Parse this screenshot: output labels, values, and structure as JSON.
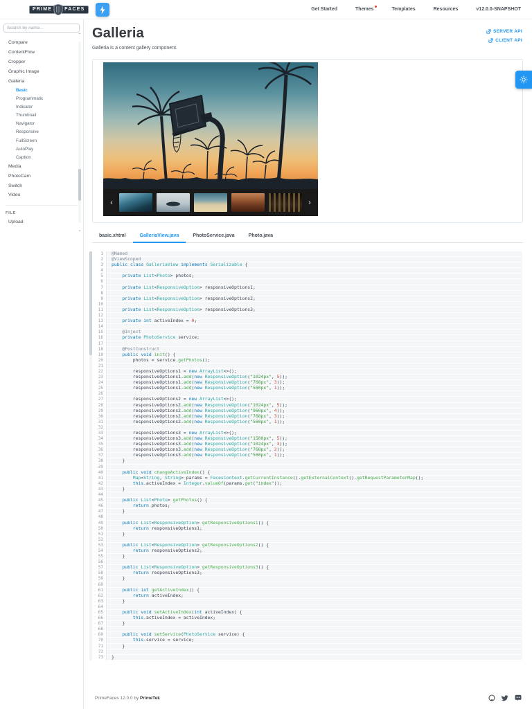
{
  "topbar": {
    "logo": {
      "left": "PRIME",
      "right": "FACES"
    },
    "nav_items": [
      {
        "label": "Get Started",
        "badge": false
      },
      {
        "label": "Themes",
        "badge": true
      },
      {
        "label": "Templates",
        "badge": false
      },
      {
        "label": "Resources",
        "badge": false
      },
      {
        "label": "v12.0.0-SNAPSHOT",
        "badge": false
      }
    ]
  },
  "sidebar": {
    "search_placeholder": "Search by name...",
    "items": [
      {
        "type": "item",
        "label": "Compare"
      },
      {
        "type": "item",
        "label": "ContentFlow"
      },
      {
        "type": "item",
        "label": "Cropper"
      },
      {
        "type": "item",
        "label": "Graphic Image"
      },
      {
        "type": "item",
        "label": "Galleria"
      },
      {
        "type": "sub",
        "label": "Basic",
        "active": true
      },
      {
        "type": "sub",
        "label": "Programmatic"
      },
      {
        "type": "sub",
        "label": "Indicator"
      },
      {
        "type": "sub",
        "label": "Thumbnail"
      },
      {
        "type": "sub",
        "label": "Navigator"
      },
      {
        "type": "sub",
        "label": "Responsive"
      },
      {
        "type": "sub",
        "label": "FullScreen"
      },
      {
        "type": "sub",
        "label": "AutoPlay"
      },
      {
        "type": "sub",
        "label": "Caption"
      },
      {
        "type": "item",
        "label": "Media"
      },
      {
        "type": "item",
        "label": "PhotoCam"
      },
      {
        "type": "item",
        "label": "Switch"
      },
      {
        "type": "item",
        "label": "Video"
      },
      {
        "type": "divider"
      },
      {
        "type": "section",
        "label": "FILE"
      },
      {
        "type": "item",
        "label": "Upload"
      }
    ]
  },
  "page": {
    "title": "Galleria",
    "subtitle": "Galleria is a content gallery component."
  },
  "api_links": [
    {
      "label": "SERVER API"
    },
    {
      "label": "CLIENT API"
    }
  ],
  "galleria": {
    "main_image": "basketball-hoop-palm-trees-sunset",
    "thumbnails": [
      {
        "name": "harbor-city"
      },
      {
        "name": "ship-at-sea"
      },
      {
        "name": "palm-sunset"
      },
      {
        "name": "red-mountains"
      },
      {
        "name": "dark-building"
      }
    ]
  },
  "icons": {
    "scroll_up": "⌃",
    "scroll_down": "⌄",
    "chevron_left": "‹",
    "chevron_right": "›"
  },
  "tabs": [
    {
      "label": "basic.xhtml",
      "active": false
    },
    {
      "label": "GalleriaView.java",
      "active": true
    },
    {
      "label": "PhotoService.java",
      "active": false
    },
    {
      "label": "Photo.java",
      "active": false
    }
  ],
  "code": {
    "language": "java",
    "lines": [
      "@Named",
      "@ViewScoped",
      "public class GalleriaView implements Serializable {",
      "",
      "    private List<Photo> photos;",
      "",
      "    private List<ResponsiveOption> responsiveOptions1;",
      "",
      "    private List<ResponsiveOption> responsiveOptions2;",
      "",
      "    private List<ResponsiveOption> responsiveOptions3;",
      "",
      "    private int activeIndex = 0;",
      "",
      "    @Inject",
      "    private PhotoService service;",
      "",
      "    @PostConstruct",
      "    public void init() {",
      "        photos = service.getPhotos();",
      "",
      "        responsiveOptions1 = new ArrayList<>();",
      "        responsiveOptions1.add(new ResponsiveOption(\"1024px\", 5));",
      "        responsiveOptions1.add(new ResponsiveOption(\"768px\", 3));",
      "        responsiveOptions1.add(new ResponsiveOption(\"560px\", 1));",
      "",
      "        responsiveOptions2 = new ArrayList<>();",
      "        responsiveOptions2.add(new ResponsiveOption(\"1024px\", 5));",
      "        responsiveOptions2.add(new ResponsiveOption(\"960px\", 4));",
      "        responsiveOptions2.add(new ResponsiveOption(\"768px\", 3));",
      "        responsiveOptions2.add(new ResponsiveOption(\"560px\", 1));",
      "",
      "        responsiveOptions3 = new ArrayList<>();",
      "        responsiveOptions3.add(new ResponsiveOption(\"1500px\", 5));",
      "        responsiveOptions3.add(new ResponsiveOption(\"1024px\", 3));",
      "        responsiveOptions3.add(new ResponsiveOption(\"768px\", 2));",
      "        responsiveOptions3.add(new ResponsiveOption(\"560px\", 1));",
      "    }",
      "",
      "    public void changeActiveIndex() {",
      "        Map<String, String> params = FacesContext.getCurrentInstance().getExternalContext().getRequestParameterMap();",
      "        this.activeIndex = Integer.valueOf(params.get(\"index\"));",
      "    }",
      "",
      "    public List<Photo> getPhotos() {",
      "        return photos;",
      "    }",
      "",
      "    public List<ResponsiveOption> getResponsiveOptions1() {",
      "        return responsiveOptions1;",
      "    }",
      "",
      "    public List<ResponsiveOption> getResponsiveOptions2() {",
      "        return responsiveOptions2;",
      "    }",
      "",
      "    public List<ResponsiveOption> getResponsiveOptions3() {",
      "        return responsiveOptions3;",
      "    }",
      "",
      "    public int getActiveIndex() {",
      "        return activeIndex;",
      "    }",
      "",
      "    public void setActiveIndex(int activeIndex) {",
      "        this.activeIndex = activeIndex;",
      "    }",
      "",
      "    public void setService(PhotoService service) {",
      "        this.service = service;",
      "    }",
      "",
      "}"
    ]
  },
  "footer": {
    "text": "PrimeFaces 12.0.0 by",
    "brand": "PrimeTek"
  },
  "colors": {
    "accent": "#2196f3",
    "badge": "#e53935",
    "thumb_strip_bg": "#191919"
  }
}
